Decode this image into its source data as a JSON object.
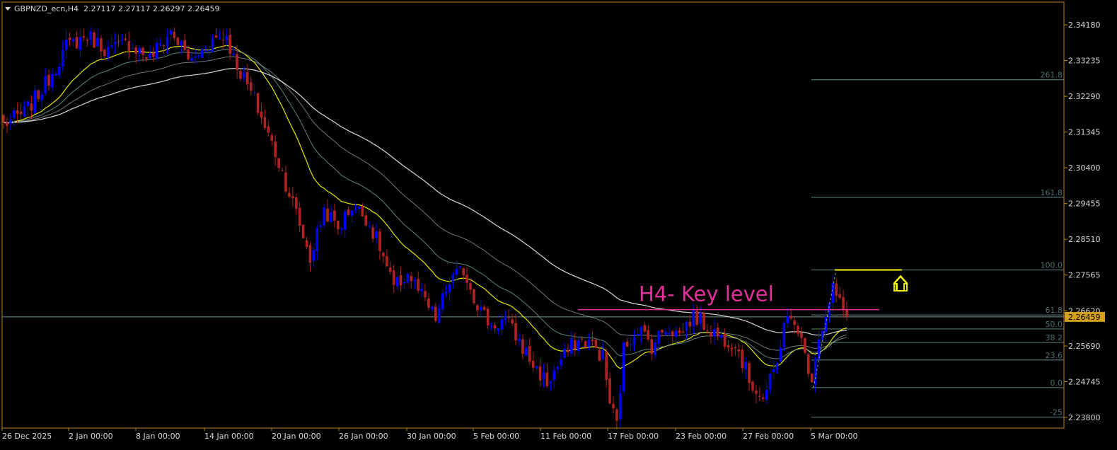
{
  "header": {
    "symbol_label": "GBPNZD_ecn,H4",
    "ohlc": "2.27117 2.27117 2.26297 2.26459"
  },
  "colors": {
    "background": "#000000",
    "frame": "#b8860b",
    "bull": "#0000ff",
    "bear": "#b22222",
    "ema_fast": "#ffff00",
    "ema_mid": "#6a8f8f",
    "ema_slow": "#f0f0f0",
    "fib": "#4f6f6f",
    "key_level": "#e0309a",
    "arrow": "#ffff00",
    "current_price_bg": "#d4a017",
    "axis_text": "#d8d8d8"
  },
  "chart_data": {
    "type": "candlestick",
    "timeframe": "H4",
    "ylim": [
      2.2352,
      2.3478
    ],
    "price_ticks": [
      "2.34180",
      "2.33235",
      "2.32290",
      "2.31345",
      "2.30400",
      "2.29455",
      "2.28510",
      "2.27565",
      "2.26620",
      "2.25690",
      "2.24745",
      "2.23800"
    ],
    "current_price": "2.26459",
    "x_labels": [
      "26 Dec 2025",
      "2 Jan 00:00",
      "8 Jan 00:00",
      "14 Jan 00:00",
      "20 Jan 00:00",
      "26 Jan 00:00",
      "30 Jan 00:00",
      "5 Feb 00:00",
      "11 Feb 00:00",
      "17 Feb 00:00",
      "23 Feb 00:00",
      "27 Feb 00:00",
      "5 Mar 00:00"
    ],
    "anchors": [
      [
        0,
        2.3155
      ],
      [
        6,
        2.3185
      ],
      [
        12,
        2.326
      ],
      [
        18,
        2.336
      ],
      [
        24,
        2.339
      ],
      [
        30,
        2.335
      ],
      [
        36,
        2.337
      ],
      [
        42,
        2.333
      ],
      [
        48,
        2.34
      ],
      [
        54,
        2.332
      ],
      [
        60,
        2.338
      ],
      [
        64,
        2.339
      ],
      [
        66,
        2.333
      ],
      [
        72,
        2.322
      ],
      [
        78,
        2.308
      ],
      [
        84,
        2.292
      ],
      [
        88,
        2.28
      ],
      [
        92,
        2.293
      ],
      [
        96,
        2.288
      ],
      [
        100,
        2.294
      ],
      [
        104,
        2.291
      ],
      [
        108,
        2.283
      ],
      [
        112,
        2.272
      ],
      [
        116,
        2.276
      ],
      [
        120,
        2.27
      ],
      [
        124,
        2.264
      ],
      [
        128,
        2.274
      ],
      [
        132,
        2.277
      ],
      [
        136,
        2.268
      ],
      [
        140,
        2.262
      ],
      [
        144,
        2.264
      ],
      [
        148,
        2.258
      ],
      [
        152,
        2.252
      ],
      [
        156,
        2.247
      ],
      [
        160,
        2.253
      ],
      [
        164,
        2.258
      ],
      [
        168,
        2.258
      ],
      [
        172,
        2.254
      ],
      [
        174,
        2.242
      ],
      [
        176,
        2.236
      ],
      [
        178,
        2.256
      ],
      [
        182,
        2.262
      ],
      [
        186,
        2.257
      ],
      [
        190,
        2.262
      ],
      [
        194,
        2.26
      ],
      [
        198,
        2.265
      ],
      [
        202,
        2.262
      ],
      [
        206,
        2.259
      ],
      [
        210,
        2.258
      ],
      [
        214,
        2.248
      ],
      [
        218,
        2.243
      ],
      [
        222,
        2.252
      ],
      [
        224,
        2.264
      ],
      [
        228,
        2.262
      ],
      [
        230,
        2.254
      ],
      [
        232,
        2.249
      ],
      [
        234,
        2.26
      ],
      [
        236,
        2.264
      ],
      [
        238,
        2.272
      ],
      [
        240,
        2.268
      ],
      [
        242,
        2.2646
      ]
    ],
    "fib_levels": [
      {
        "label": "261.8",
        "price": 2.3273
      },
      {
        "label": "161.8",
        "price": 2.2962
      },
      {
        "label": "100.0",
        "price": 2.277
      },
      {
        "label": "61.8",
        "price": 2.2651
      },
      {
        "label": "50.0",
        "price": 2.2614
      },
      {
        "label": "38.2",
        "price": 2.2578
      },
      {
        "label": "23.6",
        "price": 2.2532
      },
      {
        "label": "0.0",
        "price": 2.2459
      },
      {
        "label": "-25",
        "price": 2.2381
      }
    ],
    "key_level": {
      "label": "H4- Key level",
      "price": 2.2665
    },
    "yellow_level": {
      "price": 2.277
    },
    "ema_periods": [
      21,
      34,
      55,
      89
    ]
  }
}
